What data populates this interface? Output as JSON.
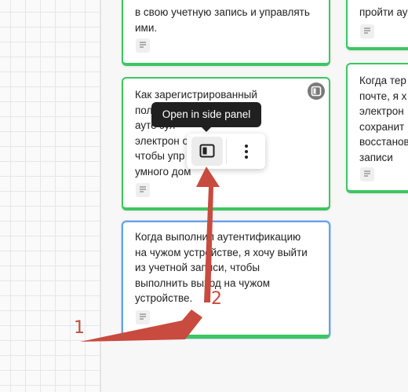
{
  "cards": [
    {
      "text": "в свою учетную запись и управлять\nими."
    },
    {
      "text": "пройти ау"
    },
    {
      "text": "Как зарегистрированный\nпол                         олнить\nауте                          зуя\nэлектрон                 оль,\nчтобы упр                    твами\nумного дом"
    },
    {
      "text": "Когда тер\nпочте, я х\nэлектрон\nсохранит\nвосстанов\nзаписи"
    },
    {
      "text": "Когда выполнил аутентификацию\nна чужом устройстве, я хочу выйти\nиз учетной записи, чтобы\nвыполнить выход на чужом\nустройстве."
    }
  ],
  "tooltip": {
    "text": "Open in side panel"
  },
  "toolbar": {
    "open_panel_icon": "side-panel-icon",
    "more_icon": "more-vertical-icon"
  },
  "annotations": {
    "label_1": "1",
    "label_2": "2"
  },
  "colors": {
    "card_border": "#3cc661",
    "selected_border": "#6aa0e6",
    "arrow": "#c94a3e",
    "tooltip_bg": "#202020"
  }
}
